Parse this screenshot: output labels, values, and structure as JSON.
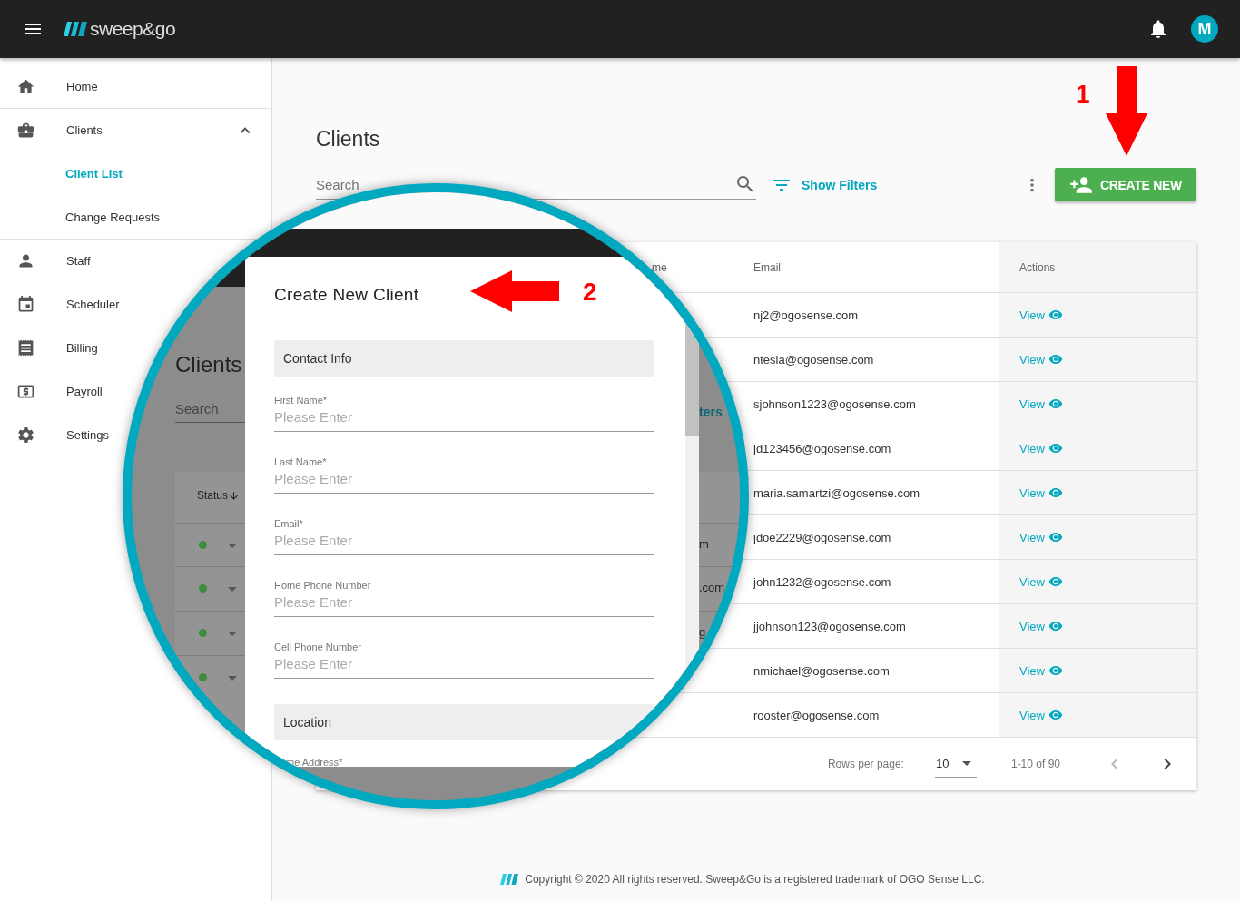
{
  "header": {
    "logo": "sweep&go",
    "avatar": "M"
  },
  "sidebar": {
    "items": [
      {
        "label": "Home",
        "selected": false
      },
      {
        "label": "Clients",
        "selected": false,
        "expanded": true,
        "children": [
          {
            "label": "Client List",
            "selected": true
          },
          {
            "label": "Change Requests",
            "selected": false
          }
        ]
      },
      {
        "label": "Staff",
        "selected": false
      },
      {
        "label": "Scheduler",
        "selected": false
      },
      {
        "label": "Billing",
        "selected": false
      },
      {
        "label": "Payroll",
        "selected": false
      },
      {
        "label": "Settings",
        "selected": false
      }
    ]
  },
  "page": {
    "title": "Clients",
    "search": {
      "placeholder": "Search"
    },
    "filters_button": "Show Filters",
    "create_button": "CREATE NEW"
  },
  "table": {
    "columns": [
      "me",
      "Email",
      "Actions"
    ],
    "rows": [
      {
        "email": "nj2@ogosense.com",
        "action": "View"
      },
      {
        "email": "ntesla@ogosense.com",
        "action": "View"
      },
      {
        "email": "sjohnson1223@ogosense.com",
        "action": "View"
      },
      {
        "email": "jd123456@ogosense.com",
        "action": "View"
      },
      {
        "email": "maria.samartzi@ogosense.com",
        "action": "View"
      },
      {
        "email": "jdoe2229@ogosense.com",
        "action": "View"
      },
      {
        "email": "john1232@ogosense.com",
        "action": "View"
      },
      {
        "email": "jjohnson123@ogosense.com",
        "action": "View"
      },
      {
        "email": "nmichael@ogosense.com",
        "action": "View"
      },
      {
        "email": "rooster@ogosense.com",
        "action": "View"
      }
    ],
    "pagination": {
      "rows_per_page_label": "Rows per page:",
      "rows_per_page": "10",
      "range": "1-10 of 90"
    }
  },
  "magnifier": {
    "background": {
      "title": "Clients",
      "search_placeholder": "Search",
      "column": "Status",
      "filters_fragment": "ters",
      "rows": [
        {
          "color": "#3d8b3d",
          "fragment": "m"
        },
        {
          "color": "#3d8b3d",
          "fragment": ".com"
        },
        {
          "color": "#3d8b3d",
          "fragment": "g"
        },
        {
          "color": "#3d8b3d"
        }
      ]
    },
    "dialog": {
      "title": "Create New Client",
      "sections": [
        {
          "title": "Contact Info",
          "fields": [
            {
              "label": "First Name*",
              "placeholder": "Please Enter"
            },
            {
              "label": "Last Name*",
              "placeholder": "Please Enter"
            },
            {
              "label": "Email*",
              "placeholder": "Please Enter"
            },
            {
              "label": "Home Phone Number",
              "placeholder": "Please Enter"
            },
            {
              "label": "Cell Phone Number",
              "placeholder": "Please Enter"
            }
          ]
        },
        {
          "title": "Location",
          "fields": [
            {
              "label": "me Address*"
            }
          ]
        }
      ]
    }
  },
  "annotations": [
    {
      "label": "1"
    },
    {
      "label": "2"
    }
  ],
  "footer": "Copyright © 2020 All rights reserved. Sweep&Go is a registered trademark of OGO Sense LLC."
}
